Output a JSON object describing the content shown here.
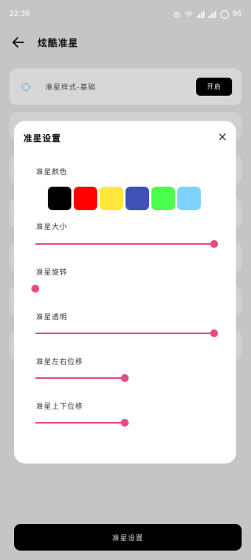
{
  "status_bar": {
    "time": "22:30",
    "battery": "96"
  },
  "app_bar": {
    "title": "炫酷准星"
  },
  "style_card": {
    "label": "准星样式-基础",
    "button_label": "开启"
  },
  "dialog": {
    "title": "准星设置",
    "color_label": "准星颜色",
    "colors": [
      "#000000",
      "#ff0000",
      "#ffe83a",
      "#3f51b5",
      "#4cff4c",
      "#7dd3fc"
    ],
    "sliders": [
      {
        "label": "准星大小",
        "value": 1.0
      },
      {
        "label": "准星旋转",
        "value": 0.0
      },
      {
        "label": "准星透明",
        "value": 1.0
      },
      {
        "label": "准星左右位移",
        "value": 0.5
      },
      {
        "label": "准星上下位移",
        "value": 0.5
      }
    ],
    "accent_color": "#e84a86"
  },
  "bottom_button": {
    "label": "准星设置"
  }
}
